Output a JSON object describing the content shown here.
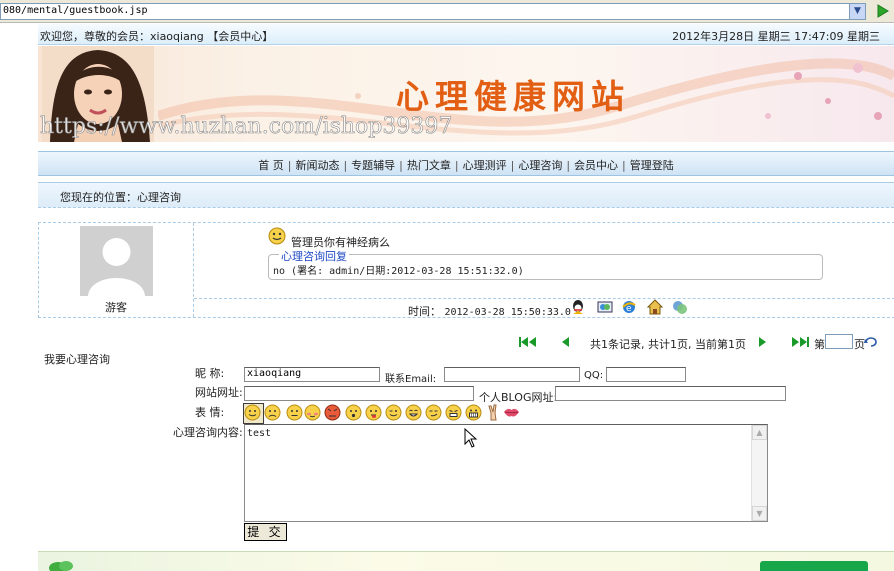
{
  "browser": {
    "url": "080/mental/guestbook.jsp"
  },
  "welcome": {
    "greeting": "欢迎您，尊敬的会员：xiaoqiang 【会员中心】",
    "datetime": "2012年3月28日 星期三 17:47:09  星期三"
  },
  "banner": {
    "title": "心理健康网站",
    "watermark": "https://www.huzhan.com/ishop39397"
  },
  "nav": {
    "items": [
      "首 页",
      "新闻动态",
      "专题辅导",
      "热门文章",
      "心理测评",
      "心理咨询",
      "会员中心",
      "管理登陆"
    ],
    "separator": "|"
  },
  "location": {
    "text": "您现在的位置：心理咨询"
  },
  "message": {
    "user": "游客",
    "body": "管理员你有神经病么",
    "reply_label": "心理咨询回复",
    "reply_text": "no (署名: admin/日期:2012-03-28 15:51:32.0)",
    "time_label": "时间：",
    "time_value": "2012-03-28 15:50:33.0",
    "icons": [
      "qq-icon",
      "msn-icon",
      "ie-homepage-icon",
      "house-icon",
      "chat-icon"
    ]
  },
  "pager": {
    "info": "共1条记录, 共计1页, 当前第1页",
    "page_label": "第",
    "page_suffix": "页"
  },
  "form": {
    "title": "我要心理咨询",
    "nickname_label": "昵    称:",
    "nickname_value": "xiaoqiang",
    "email_label": "联系Email:",
    "email_value": "",
    "qq_label": "QQ:",
    "qq_value": "",
    "website_label": "网站网址:",
    "website_value": "",
    "blog_label": "个人BLOG网址:",
    "blog_value": "",
    "emote_label": "表    情:",
    "content_label": "心理咨询内容:",
    "content_value": "test",
    "submit_label": "提 交"
  },
  "colors": {
    "banner_title": "#e25e13",
    "reply_label": "#1f48c4",
    "nav_bg": "#cfe3f4",
    "pager_arrow": "#1a9a2a"
  }
}
